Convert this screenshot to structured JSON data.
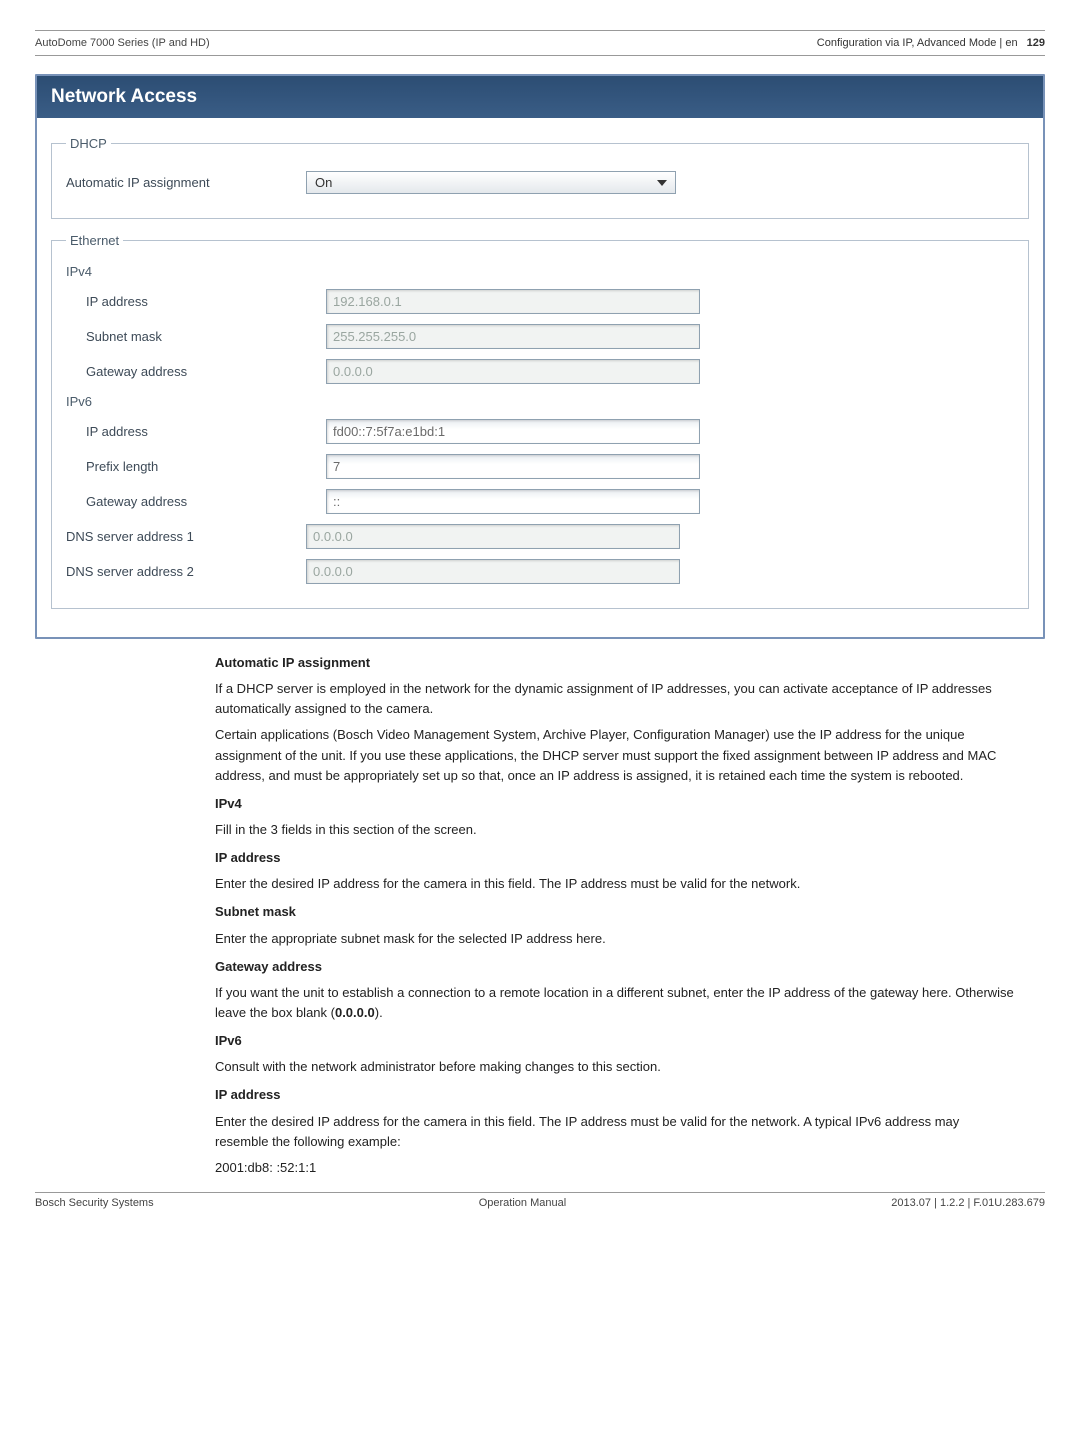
{
  "header": {
    "left": "AutoDome 7000 Series (IP and HD)",
    "right_text": "Configuration via IP, Advanced Mode | en",
    "right_page": "129"
  },
  "panel": {
    "title": "Network Access",
    "dhcp": {
      "legend": "DHCP",
      "auto_ip_label": "Automatic IP assignment",
      "auto_ip_value": "On"
    },
    "ethernet": {
      "legend": "Ethernet",
      "ipv4": {
        "sub": "IPv4",
        "ip_label": "IP address",
        "ip_value": "192.168.0.1",
        "subnet_label": "Subnet mask",
        "subnet_value": "255.255.255.0",
        "gw_label": "Gateway address",
        "gw_value": "0.0.0.0"
      },
      "ipv6": {
        "sub": "IPv6",
        "ip_label": "IP address",
        "ip_value": "fd00::7:5f7a:e1bd:1",
        "prefix_label": "Prefix length",
        "prefix_value": "7",
        "gw_label": "Gateway address",
        "gw_value": "::"
      },
      "dns1_label": "DNS server address 1",
      "dns1_value": "0.0.0.0",
      "dns2_label": "DNS server address 2",
      "dns2_value": "0.0.0.0"
    }
  },
  "body": {
    "auto_h": "Automatic IP assignment",
    "auto_p1": "If a DHCP server is employed in the network for the dynamic assignment of IP addresses, you can activate acceptance of IP addresses automatically assigned to the camera.",
    "auto_p2": "Certain applications (Bosch Video Management System, Archive Player, Configuration Manager) use the IP address for the unique assignment of the unit. If you use these applications, the DHCP server must support the fixed assignment between IP address and MAC address, and must be appropriately set up so that, once an IP address is assigned, it is retained each time the system is rebooted.",
    "ipv4_h": "IPv4",
    "ipv4_p": "Fill in the 3 fields in this section of the screen.",
    "ipaddr_h": "IP address",
    "ipaddr_p": "Enter the desired IP address for the camera in this field. The IP address must be valid for the network.",
    "subnet_h": "Subnet mask",
    "subnet_p": "Enter the appropriate subnet mask for the selected IP address here.",
    "gw_h": "Gateway address",
    "gw_p_a": "If you want the unit to establish a connection to a remote location in a different subnet, enter the IP address of the gateway here. Otherwise leave the box blank (",
    "gw_p_b": "0.0.0.0",
    "gw_p_c": ").",
    "ipv6_h": "IPv6",
    "ipv6_p": "Consult with the network administrator before making changes to this section.",
    "ipaddr6_h": "IP address",
    "ipaddr6_p1": "Enter the desired IP address for the camera in this field. The IP address must be valid for the network. A typical IPv6 address may resemble the following example:",
    "ipaddr6_p2": "2001:db8: :52:1:1"
  },
  "footer": {
    "left": "Bosch Security Systems",
    "center": "Operation Manual",
    "right": "2013.07 | 1.2.2 | F.01U.283.679"
  }
}
